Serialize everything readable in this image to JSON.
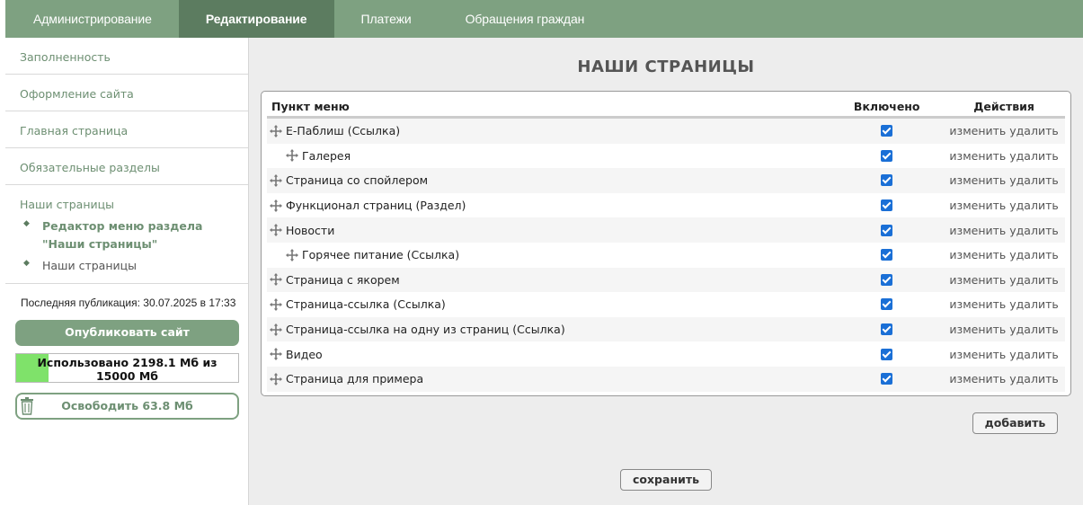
{
  "topnav": {
    "tabs": [
      {
        "label": "Администрирование",
        "active": false
      },
      {
        "label": "Редактирование",
        "active": true
      },
      {
        "label": "Платежи",
        "active": false
      },
      {
        "label": "Обращения граждан",
        "active": false
      }
    ]
  },
  "sidebar": {
    "items": [
      {
        "label": "Заполненность"
      },
      {
        "label": "Оформление сайта"
      },
      {
        "label": "Главная страница"
      },
      {
        "label": "Обязательные разделы"
      }
    ],
    "group": {
      "title": "Наши страницы",
      "subitems": [
        {
          "label": "Редактор меню раздела \"Наши страницы\"",
          "active": true
        },
        {
          "label": "Наши страницы",
          "active": false
        }
      ]
    },
    "last_publication": "Последняя публикация: 30.07.2025 в 17:33",
    "publish_label": "Опубликовать сайт",
    "usage": {
      "text": "Использовано 2198.1 Мб из 15000 Мб",
      "used_mb": 2198.1,
      "total_mb": 15000,
      "fill_color": "#7fe26a"
    },
    "free_label": "Освободить 63.8 Мб"
  },
  "main": {
    "title": "НАШИ СТРАНИЦЫ",
    "columns": {
      "menu_item": "Пункт меню",
      "enabled": "Включено",
      "actions": "Действия"
    },
    "edit_label": "изменить",
    "delete_label": "удалить",
    "rows": [
      {
        "label": "Е-Паблиш (Ссылка)",
        "level": 0,
        "enabled": true
      },
      {
        "label": "Галерея",
        "level": 1,
        "enabled": true
      },
      {
        "label": "Страница со спойлером",
        "level": 0,
        "enabled": true
      },
      {
        "label": "Функционал страниц (Раздел)",
        "level": 0,
        "enabled": true
      },
      {
        "label": "Новости",
        "level": 0,
        "enabled": true
      },
      {
        "label": "Горячее питание (Ссылка)",
        "level": 1,
        "enabled": true
      },
      {
        "label": "Страница с якорем",
        "level": 0,
        "enabled": true
      },
      {
        "label": "Страница-ссылка (Ссылка)",
        "level": 0,
        "enabled": true
      },
      {
        "label": "Страница-ссылка на одну из страниц (Ссылка)",
        "level": 0,
        "enabled": true
      },
      {
        "label": "Видео",
        "level": 0,
        "enabled": true
      },
      {
        "label": "Страница для примера",
        "level": 0,
        "enabled": true
      }
    ],
    "add_label": "добавить",
    "save_label": "сохранить"
  },
  "colors": {
    "accent": "#7ea181",
    "accent_dark": "#5c7c60",
    "checkbox": "#1a6fd6"
  }
}
